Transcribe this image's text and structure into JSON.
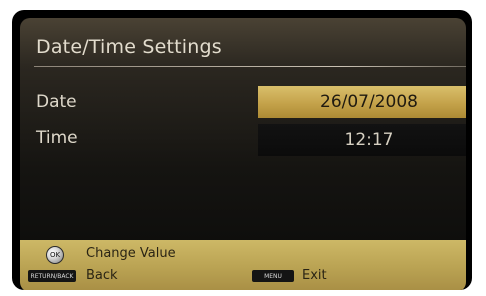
{
  "dialog": {
    "title": "Date/Time Settings"
  },
  "rows": {
    "date": {
      "label": "Date",
      "value": "26/07/2008",
      "selected": true
    },
    "time": {
      "label": "Time",
      "value": "12:17",
      "selected": false
    }
  },
  "footer": {
    "ok_icon_text": "OK",
    "change_value_label": "Change Value",
    "return_key_text": "RETURN/BACK",
    "back_label": "Back",
    "menu_key_text": "MENU",
    "exit_label": "Exit"
  },
  "colors": {
    "accent_gold": "#c4a24a",
    "footer_gold": "#bba454",
    "panel_dark": "#151411"
  },
  "icons": [
    "ok-button-icon",
    "return-key-icon",
    "menu-key-icon"
  ]
}
